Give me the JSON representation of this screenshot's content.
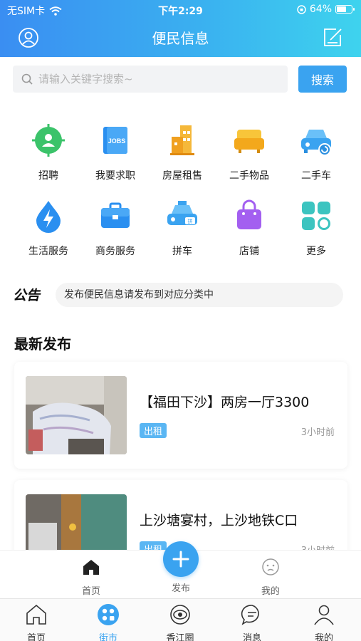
{
  "status_bar": {
    "carrier": "无SIM卡",
    "time": "下午2:29",
    "battery": "64%",
    "battery_level": 0.64
  },
  "header": {
    "title": "便民信息"
  },
  "search": {
    "placeholder": "请输入关键字搜索~",
    "button_label": "搜索"
  },
  "categories": [
    {
      "label": "招聘",
      "icon": "recruit-icon"
    },
    {
      "label": "我要求职",
      "icon": "jobs-icon"
    },
    {
      "label": "房屋租售",
      "icon": "house-icon"
    },
    {
      "label": "二手物品",
      "icon": "sofa-icon"
    },
    {
      "label": "二手车",
      "icon": "car-icon"
    },
    {
      "label": "生活服务",
      "icon": "lightning-icon"
    },
    {
      "label": "商务服务",
      "icon": "briefcase-icon"
    },
    {
      "label": "拼车",
      "icon": "carpool-icon"
    },
    {
      "label": "店铺",
      "icon": "shop-bag-icon"
    },
    {
      "label": "更多",
      "icon": "more-icon"
    }
  ],
  "notice": {
    "logo": "公告",
    "text": "发布便民信息请发布到对应分类中"
  },
  "latest": {
    "title": "最新发布",
    "items": [
      {
        "title": "【福田下沙】两房一厅3300",
        "tag": "出租",
        "time": "3小时前"
      },
      {
        "title": "上沙塘宴村，上沙地铁C口",
        "tag": "出租",
        "time": "3小时前"
      }
    ]
  },
  "inner_tabs": {
    "home": "首页",
    "publish": "发布",
    "mine": "我的"
  },
  "main_tabs": [
    {
      "label": "首页",
      "icon": "home-icon"
    },
    {
      "label": "街市",
      "icon": "street-market-icon"
    },
    {
      "label": "香江圈",
      "icon": "circle-icon"
    },
    {
      "label": "消息",
      "icon": "message-icon"
    },
    {
      "label": "我的",
      "icon": "profile-icon"
    }
  ],
  "colors": {
    "accent": "#3aa3f0",
    "header_start": "#3a8ef2",
    "header_end": "#3ed3ee"
  }
}
